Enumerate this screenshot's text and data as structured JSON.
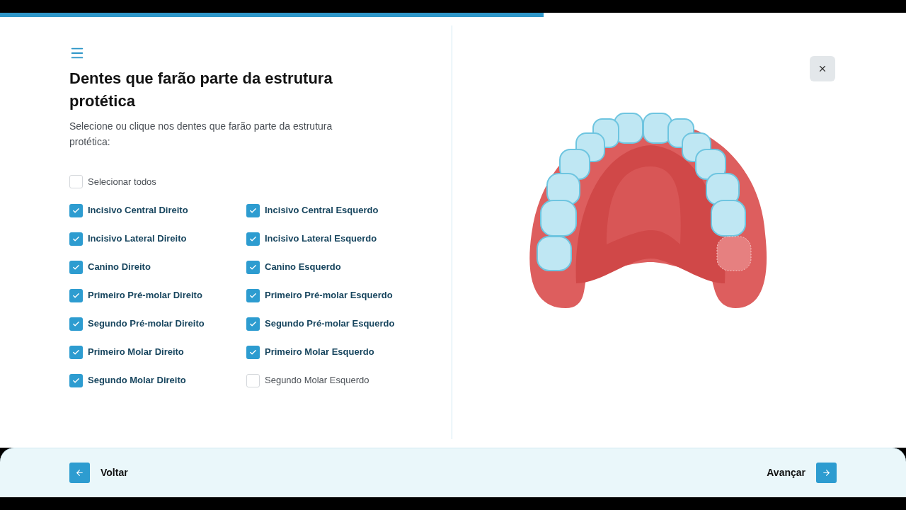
{
  "progress": {
    "level": 0.6
  },
  "title": "Dentes que farão parte da estrutura protética",
  "subtitle": "Selecione ou clique nos dentes que farão parte da estrutura protética:",
  "select_all": {
    "label": "Selecionar todos",
    "checked": false
  },
  "teeth": [
    {
      "label": "Incisivo Central Direito",
      "checked": true
    },
    {
      "label": "Incisivo Central Esquerdo",
      "checked": true
    },
    {
      "label": "Incisivo Lateral Direito",
      "checked": true
    },
    {
      "label": "Incisivo Lateral Esquerdo",
      "checked": true
    },
    {
      "label": "Canino Direito",
      "checked": true
    },
    {
      "label": "Canino Esquerdo",
      "checked": true
    },
    {
      "label": "Primeiro Pré-molar Direito",
      "checked": true
    },
    {
      "label": "Primeiro Pré-molar Esquerdo",
      "checked": true
    },
    {
      "label": "Segundo Pré-molar Direito",
      "checked": true
    },
    {
      "label": "Segundo Pré-molar Esquerdo",
      "checked": true
    },
    {
      "label": "Primeiro Molar Direito",
      "checked": true
    },
    {
      "label": "Primeiro Molar Esquerdo",
      "checked": true
    },
    {
      "label": "Segundo Molar Direito",
      "checked": true
    },
    {
      "label": "Segundo Molar Esquerdo",
      "checked": false
    }
  ],
  "footer": {
    "back": "Voltar",
    "next": "Avançar"
  }
}
